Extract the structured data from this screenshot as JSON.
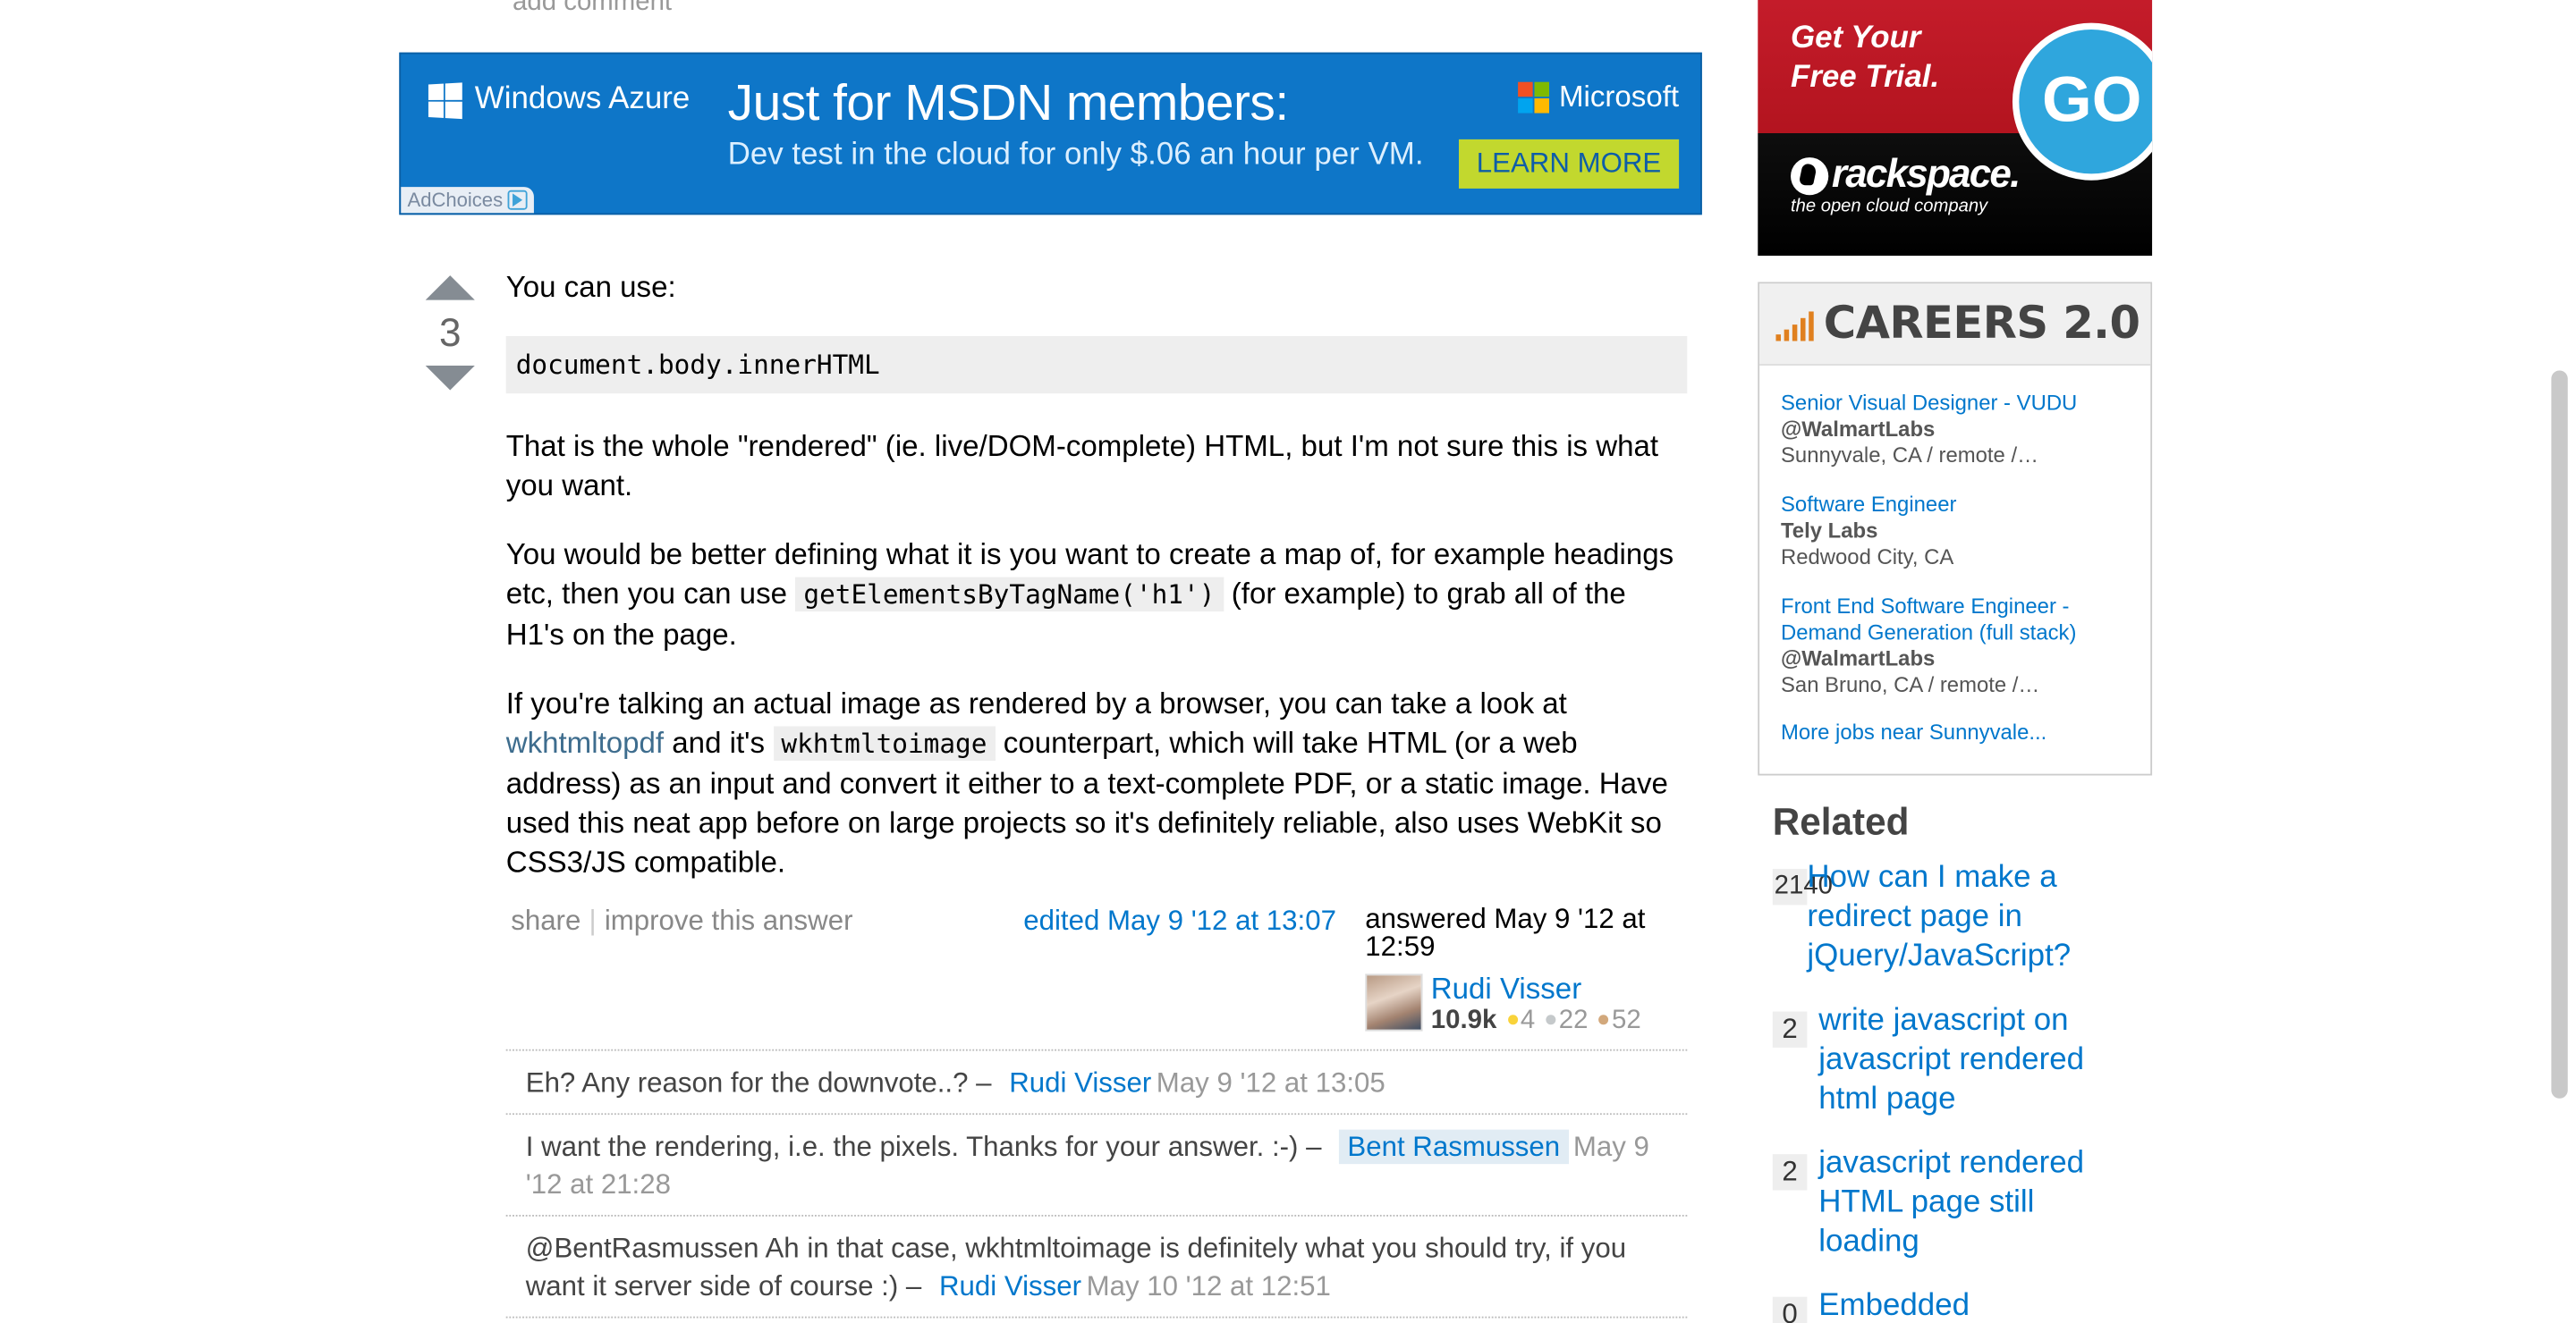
{
  "top": {
    "add_comment": "add comment"
  },
  "azure_ad": {
    "brand": "Windows Azure",
    "headline": "Just for MSDN members:",
    "subline": "Dev test in the cloud for only $.06 an hour per VM.",
    "microsoft": "Microsoft",
    "cta": "LEARN MORE",
    "adchoices": "AdChoices",
    "colors": {
      "bg": "#0e76c8",
      "cta": "#c2d82e"
    }
  },
  "answer": {
    "votes": "3",
    "intro": "You can use:",
    "code_block": "document.body.innerHTML",
    "p1": "That is the whole \"rendered\" (ie. live/DOM-complete) HTML, but I'm not sure this is what you want.",
    "p2_a": "You would be better defining what it is you want to create a map of, for example headings etc, then you can use ",
    "p2_code": "getElementsByTagName('h1')",
    "p2_b": " (for example) to grab all of the H1's on the page.",
    "p3_a": "If you're talking an actual image as rendered by a browser, you can take a look at ",
    "p3_link": "wkhtmltopdf",
    "p3_b": " and it's ",
    "p3_code": "wkhtmltoimage",
    "p3_c": " counterpart, which will take HTML (or a web address) as an input and convert it either to a text-complete PDF, or a static image. Have used this neat app before on large projects so it's definitely reliable, also uses WebKit so CSS3/JS compatible.",
    "menu": {
      "share": "share",
      "improve": "improve this answer"
    },
    "edited": "edited May 9 '12 at 13:07",
    "answered": "answered May 9 '12 at 12:59",
    "user": {
      "name": "Rudi Visser",
      "rep": "10.9k",
      "gold": "4",
      "silver": "22",
      "bronze": "52"
    }
  },
  "comments": [
    {
      "text": "Eh? Any reason for the downvote..? – ",
      "user": "Rudi Visser",
      "date": "May 9 '12 at 13:05"
    },
    {
      "text": "I want the rendering, i.e. the pixels. Thanks for your answer. :-) – ",
      "user": "Bent Rasmussen",
      "date": "May 9 '12 at 21:28"
    },
    {
      "text": "@BentRasmussen Ah in that case, wkhtmltoimage is definitely what you should try, if you want it server side of course :) – ",
      "user": "Rudi Visser",
      "date": "May 10 '12 at 12:51"
    }
  ],
  "rackspace_ad": {
    "line1": "Get Your",
    "line2": "Free Trial.",
    "go": "GO",
    "logo": "rackspace.",
    "tagline": "the open cloud company"
  },
  "careers": {
    "title": "CAREERS 2.0",
    "jobs": [
      {
        "title": "Senior Visual Designer - VUDU",
        "company": "@WalmartLabs",
        "location": "Sunnyvale, CA / remote /…"
      },
      {
        "title": "Software Engineer",
        "company": "Tely Labs",
        "location": "Redwood City, CA"
      },
      {
        "title": "Front End Software Engineer - Demand Generation (full stack)",
        "company": "@WalmartLabs",
        "location": "San Bruno, CA / remote /…"
      }
    ],
    "more": "More jobs near Sunnyvale..."
  },
  "related": {
    "heading": "Related",
    "items": [
      {
        "count": "2140",
        "title": "How can I make a redirect page in jQuery/JavaScript?"
      },
      {
        "count": "2",
        "title": "write javascript on javascript rendered html page"
      },
      {
        "count": "2",
        "title": "javascript rendered HTML page still loading"
      },
      {
        "count": "0",
        "title": "Embedded"
      }
    ]
  }
}
